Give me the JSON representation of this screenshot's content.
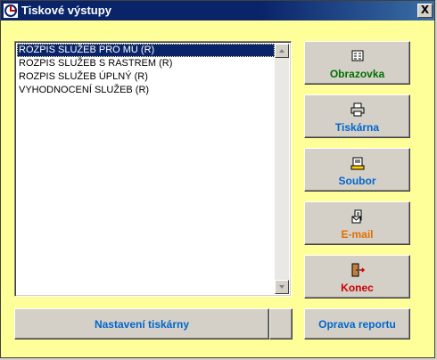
{
  "window": {
    "title": "Tiskové výstupy",
    "close_label": "X"
  },
  "report_list": {
    "items": [
      "ROZPIS SLUŽEB PRO MÚ (R)",
      "ROZPIS SLUŽEB S RASTREM (R)",
      "ROZPIS SLUŽEB ÚPLNÝ (R)",
      "VYHODNOCENÍ SLUŽEB (R)"
    ],
    "selected_index": 0
  },
  "buttons": {
    "screen": {
      "label": "Obrazovka",
      "color": "#007000",
      "icon": "screen-icon"
    },
    "printer": {
      "label": "Tiskárna",
      "color": "#0066cc",
      "icon": "printer-icon"
    },
    "file": {
      "label": "Soubor",
      "color": "#0066cc",
      "icon": "file-icon"
    },
    "email": {
      "label": "E-mail",
      "color": "#e07000",
      "icon": "email-icon"
    },
    "exit": {
      "label": "Konec",
      "color": "#cc0000",
      "icon": "exit-door-icon"
    },
    "printer_settings": {
      "label": "Nastavení tiskárny",
      "color": "#0066cc"
    },
    "edit_report": {
      "label": "Oprava reportu",
      "color": "#0066cc"
    }
  },
  "colors": {
    "background": "#ffff99",
    "title_bar": "#0a246a",
    "button_face": "#d4d0c8"
  }
}
